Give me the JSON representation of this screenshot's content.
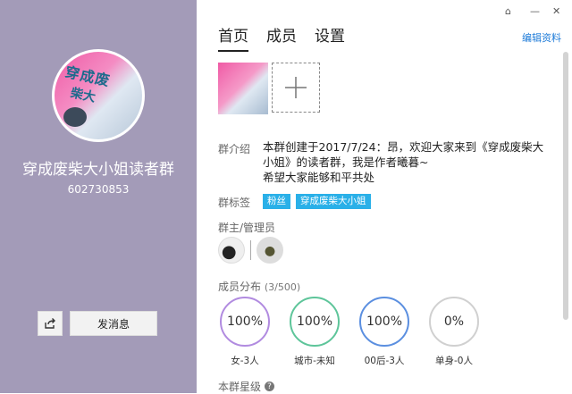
{
  "window": {
    "controls": [
      "⌂",
      "—",
      "✕"
    ]
  },
  "profile": {
    "name": "穿成废柴大小姐读者群",
    "id": "602730853",
    "avatar_text": [
      "穿成废",
      "柴大"
    ],
    "send_message_label": "发消息"
  },
  "tabs": [
    {
      "label": "首页",
      "active": true
    },
    {
      "label": "成员",
      "active": false
    },
    {
      "label": "设置",
      "active": false
    }
  ],
  "edit_profile_label": "编辑资料",
  "intro": {
    "label": "群介绍",
    "text": "本群创建于2017/7/24：昂，欢迎大家来到《穿成废柴大小姐》的读者群，我是作者曦暮~\n希望大家能够和平共处"
  },
  "tags": {
    "label": "群标签",
    "items": [
      "粉丝",
      "穿成废柴大小姐"
    ]
  },
  "admins": {
    "label": "群主/管理员"
  },
  "distribution": {
    "label": "成员分布",
    "count": "(3/500)",
    "items": [
      {
        "value": "100%",
        "label": "女-3人",
        "color": "#b18be0"
      },
      {
        "value": "100%",
        "label": "城市-未知",
        "color": "#5ec59a"
      },
      {
        "value": "100%",
        "label": "00后-3人",
        "color": "#5b8fe0"
      },
      {
        "value": "0%",
        "label": "单身-0人",
        "color": "#d0d0d0"
      }
    ]
  },
  "level_label": "本群星级",
  "colors": {
    "sidebar": "#a39bb8",
    "accent": "#1e7bd8",
    "tag": "#2ab0e8"
  }
}
